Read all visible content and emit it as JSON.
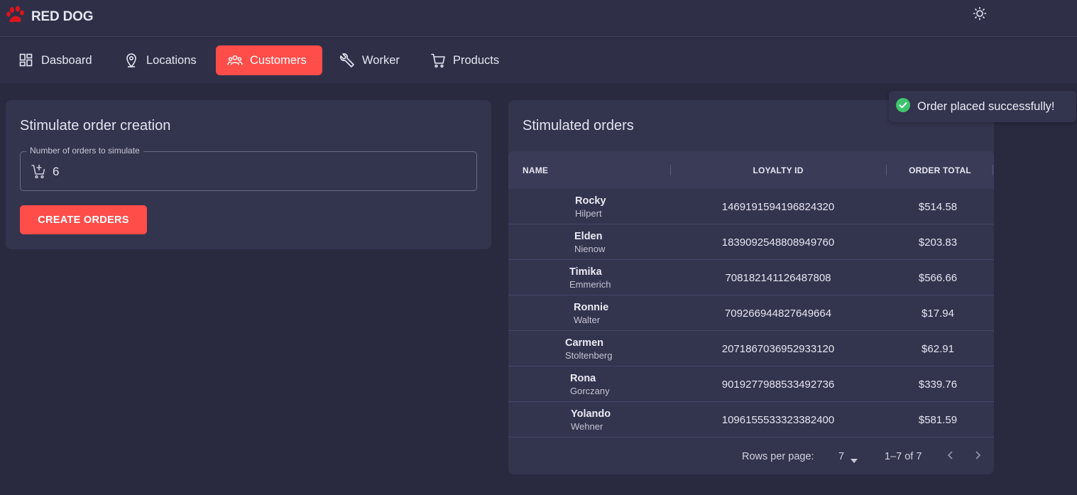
{
  "brand": {
    "name": "RED DOG",
    "logo_icon": "paw-icon",
    "logo_color": "#e0141b"
  },
  "header": {
    "theme_toggle_icon": "sun-icon"
  },
  "nav": {
    "items": [
      {
        "label": "Dasboard",
        "icon": "dashboard-icon"
      },
      {
        "label": "Locations",
        "icon": "location-pin-icon"
      },
      {
        "label": "Customers",
        "icon": "people-icon",
        "active": true
      },
      {
        "label": "Worker",
        "icon": "wrench-icon"
      },
      {
        "label": "Products",
        "icon": "cart-icon"
      }
    ],
    "accent_color": "#ff4d4a"
  },
  "simulate": {
    "title": "Stimulate order creation",
    "field_label": "Number of orders to simulate",
    "field_value": "6",
    "button_label": "CREATE ORDERS"
  },
  "orders": {
    "title": "Stimulated orders",
    "columns": [
      "NAME",
      "LOYALTY ID",
      "ORDER TOTAL"
    ],
    "rows": [
      {
        "first": "Rocky",
        "last": "Hilpert",
        "loyalty_id": "1469191594196824320",
        "total": "$514.58"
      },
      {
        "first": "Elden",
        "last": "Nienow",
        "loyalty_id": "1839092548808949760",
        "total": "$203.83"
      },
      {
        "first": "Timika",
        "last": "Emmerich",
        "loyalty_id": "708182141126487808",
        "total": "$566.66"
      },
      {
        "first": "Ronnie",
        "last": "Walter",
        "loyalty_id": "709266944827649664",
        "total": "$17.94"
      },
      {
        "first": "Carmen",
        "last": "Stoltenberg",
        "loyalty_id": "2071867036952933120",
        "total": "$62.91"
      },
      {
        "first": "Rona",
        "last": "Gorczany",
        "loyalty_id": "9019277988533492736",
        "total": "$339.76"
      },
      {
        "first": "Yolando",
        "last": "Wehner",
        "loyalty_id": "1096155533323382400",
        "total": "$581.59"
      }
    ],
    "footer": {
      "rows_per_page_label": "Rows per page:",
      "rows_per_page_value": "7",
      "range_label": "1–7 of 7"
    }
  },
  "toast": {
    "message": "Order placed successfully!",
    "icon": "check-circle-icon",
    "color": "#3ec46d"
  }
}
